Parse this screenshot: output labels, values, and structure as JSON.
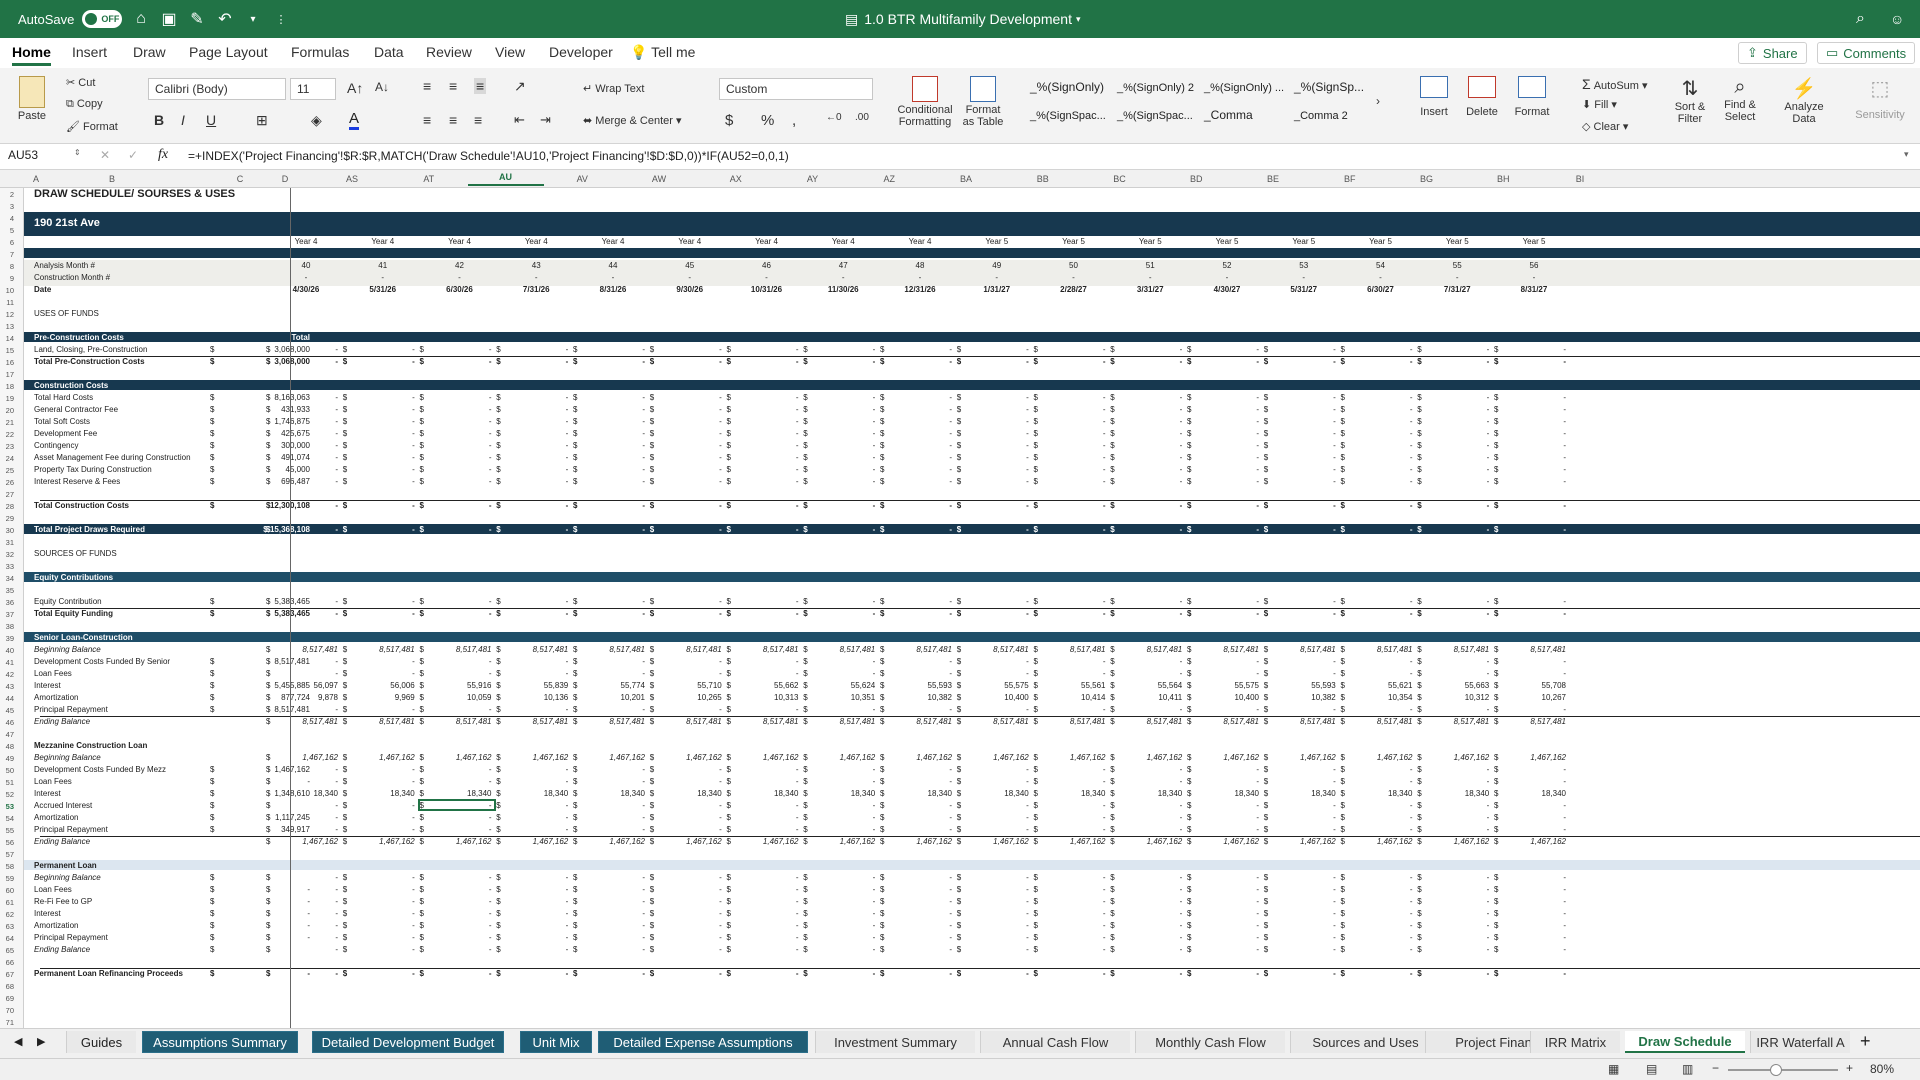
{
  "titlebar": {
    "autosave": "AutoSave",
    "autosave_state": "OFF",
    "doc_title": "1.0 BTR Multifamily Development"
  },
  "tabs": [
    "Home",
    "Insert",
    "Draw",
    "Page Layout",
    "Formulas",
    "Data",
    "Review",
    "View",
    "Developer"
  ],
  "tell_me": "Tell me",
  "share": "Share",
  "comments": "Comments",
  "ribbon": {
    "paste": "Paste",
    "cut": "Cut",
    "copy": "Copy",
    "format": "Format",
    "font_name": "Calibri (Body)",
    "font_size": "11",
    "wrap_text": "Wrap Text",
    "merge_center": "Merge & Center",
    "number_format": "Custom",
    "conditional": "Conditional",
    "formatting": "Formatting",
    "format_as": "Format",
    "as_table": "as Table",
    "styles": [
      "_%(SignOnly)",
      "_%(SignOnly) 2",
      "_%(SignOnly) ...",
      "_%(SignSp...",
      "_%(SignSpac...",
      "_%(SignSpac...",
      "_Comma",
      "_Comma 2"
    ],
    "insert": "Insert",
    "delete": "Delete",
    "format_cells": "Format",
    "autosum": "AutoSum",
    "fill": "Fill",
    "clear": "Clear",
    "sort": "Sort &",
    "filter": "Filter",
    "find": "Find &",
    "select": "Select",
    "analyze": "Analyze",
    "data": "Data",
    "sensitivity": "Sensitivity"
  },
  "formula": {
    "name_box": "AU53",
    "fx": "fx",
    "text": "=+INDEX('Project Financing'!$R:$R,MATCH('Draw Schedule'!AU10,'Project Financing'!$D:$D,0))*IF(AU52=0,0,1)"
  },
  "col_letters": [
    "A",
    "B",
    "C",
    "D",
    "AS",
    "AT",
    "AU",
    "AV",
    "AW",
    "AX",
    "AY",
    "AZ",
    "BA",
    "BB",
    "BC",
    "BD",
    "BE",
    "BF",
    "BG",
    "BH",
    "BI"
  ],
  "rows": [
    "2",
    "3",
    "4",
    "5",
    "6",
    "7",
    "8",
    "9",
    "10",
    "11",
    "12",
    "13",
    "14",
    "15",
    "16",
    "17",
    "18",
    "19",
    "20",
    "21",
    "22",
    "23",
    "24",
    "25",
    "26",
    "27",
    "28",
    "29",
    "30",
    "31",
    "32",
    "33",
    "34",
    "35",
    "36",
    "37",
    "38",
    "39",
    "40",
    "41",
    "42",
    "43",
    "44",
    "45",
    "46",
    "47",
    "48",
    "49",
    "50",
    "51",
    "52",
    "53",
    "54",
    "55",
    "56",
    "57",
    "58",
    "59",
    "60",
    "61",
    "62",
    "63",
    "64",
    "65",
    "66",
    "67",
    "68",
    "69",
    "70",
    "71"
  ],
  "sheet": {
    "title": "DRAW SCHEDULE/ SOURSES & USES",
    "property": "190 21st Ave",
    "years": [
      "Year 4",
      "Year 4",
      "Year 4",
      "Year 4",
      "Year 4",
      "Year 4",
      "Year 4",
      "Year 4",
      "Year 4",
      "Year 5",
      "Year 5",
      "Year 5",
      "Year 5",
      "Year 5",
      "Year 5",
      "Year 5",
      "Year 5"
    ],
    "analysis_label": "Analysis Month #",
    "construction_label": "Construction Month #",
    "date_label": "Date",
    "months": [
      "40",
      "41",
      "42",
      "43",
      "44",
      "45",
      "46",
      "47",
      "48",
      "49",
      "50",
      "51",
      "52",
      "53",
      "54",
      "55",
      "56"
    ],
    "dashes": [
      "-",
      "-",
      "-",
      "-",
      "-",
      "-",
      "-",
      "-",
      "-",
      "-",
      "-",
      "-",
      "-",
      "-",
      "-",
      "-",
      "-"
    ],
    "dates": [
      "4/30/26",
      "5/31/26",
      "6/30/26",
      "7/31/26",
      "8/31/26",
      "9/30/26",
      "10/31/26",
      "11/30/26",
      "12/31/26",
      "1/31/27",
      "2/28/27",
      "3/31/27",
      "4/30/27",
      "5/31/27",
      "6/30/27",
      "7/31/27",
      "8/31/27"
    ],
    "uses": "USES OF FUNDS",
    "sources": "SOURCES OF FUNDS",
    "pre_hdr": "Pre-Construction Costs",
    "total_hdr": "Total",
    "lines": [
      {
        "row": 15,
        "label": "Land, Closing, Pre-Construction",
        "val": "3,068,000",
        "pd": true
      },
      {
        "row": 16,
        "label": "Total Pre-Construction Costs",
        "val": "3,068,000",
        "pd": true,
        "bold": true
      },
      {
        "row": 19,
        "label": "Total Hard Costs",
        "val": "8,163,063",
        "pd": true
      },
      {
        "row": 20,
        "label": "General Contractor Fee",
        "val": "431,933",
        "pd": true
      },
      {
        "row": 21,
        "label": "Total Soft Costs",
        "val": "1,746,875",
        "pd": true
      },
      {
        "row": 22,
        "label": "Development Fee",
        "val": "425,675",
        "pd": true
      },
      {
        "row": 23,
        "label": "Contingency",
        "val": "300,000",
        "pd": true
      },
      {
        "row": 24,
        "label": "Asset Management Fee during Construction",
        "val": "491,074",
        "pd": true
      },
      {
        "row": 25,
        "label": "Property Tax During Construction",
        "val": "45,000",
        "pd": true
      },
      {
        "row": 26,
        "label": "Interest Reserve & Fees",
        "val": "696,487",
        "pd": true
      },
      {
        "row": 28,
        "label": "Total Construction Costs",
        "val": "12,300,108",
        "pd": true,
        "bold": true
      },
      {
        "row": 36,
        "label": "Equity Contribution",
        "val": "5,383,465",
        "pd": true
      },
      {
        "row": 37,
        "label": "Total Equity Funding",
        "val": "5,383,465",
        "pd": true,
        "bold": true
      },
      {
        "row": 41,
        "label": "Development Costs Funded By Senior",
        "val": "8,517,481",
        "pd": true
      },
      {
        "row": 42,
        "label": "Loan Fees",
        "val": "",
        "pd": true
      },
      {
        "row": 45,
        "label": "Principal Repayment",
        "val": "8,517,481",
        "pd": true
      },
      {
        "row": 50,
        "label": "Development Costs Funded By Mezz",
        "val": "1,467,162",
        "pd": true
      },
      {
        "row": 51,
        "label": "Loan Fees",
        "val": "-",
        "pd": true
      },
      {
        "row": 53,
        "label": "Accrued Interest",
        "val": "",
        "pd": true
      },
      {
        "row": 55,
        "label": "Principal Repayment",
        "val": "349,917",
        "pd": true
      },
      {
        "row": 59,
        "label": "Beginning Balance",
        "val": "",
        "pd": true,
        "italic": true
      },
      {
        "row": 60,
        "label": "Loan Fees",
        "val": "-",
        "pd": true
      },
      {
        "row": 61,
        "label": "Re-Fi Fee to GP",
        "val": "-",
        "pd": true
      },
      {
        "row": 62,
        "label": "Interest",
        "val": "-",
        "pd": true
      },
      {
        "row": 63,
        "label": "Amortization",
        "val": "-",
        "pd": true
      },
      {
        "row": 64,
        "label": "Principal Repayment",
        "val": "-",
        "pd": true
      },
      {
        "row": 65,
        "label": "Ending Balance",
        "val": "",
        "pd": true,
        "italic": true
      },
      {
        "row": 67,
        "label": "Permanent Loan Refinancing Proceeds",
        "val": "-",
        "pd": true,
        "bold": true
      }
    ],
    "con_hdr": "Construction Costs",
    "total_draws": "Total Project Draws Required",
    "total_draws_val": "$ 15,368,108",
    "eq_hdr": "Equity Contributions",
    "senior_hdr": "Senior Loan-Construction",
    "mezz_hdr": "Mezzanine Construction Loan",
    "perm_hdr": "Permanent Loan",
    "senior_begin": "Beginning Balance",
    "senior_end": "Ending Balance",
    "senior_balance": [
      "8,517,481",
      "8,517,481",
      "8,517,481",
      "8,517,481",
      "8,517,481",
      "8,517,481",
      "8,517,481",
      "8,517,481",
      "8,517,481",
      "8,517,481",
      "8,517,481",
      "8,517,481",
      "8,517,481",
      "8,517,481",
      "8,517,481",
      "8,517,481",
      "8,517,481"
    ],
    "interest_label": "Interest",
    "interest_total": "5,455,885",
    "senior_interest": [
      "56,097",
      "56,006",
      "55,916",
      "55,839",
      "55,774",
      "55,710",
      "55,662",
      "55,624",
      "55,593",
      "55,575",
      "55,561",
      "55,564",
      "55,575",
      "55,593",
      "55,621",
      "55,663",
      "55,708"
    ],
    "amort_label": "Amortization",
    "amort_total": "877,724",
    "senior_amort": [
      "9,878",
      "9,969",
      "10,059",
      "10,136",
      "10,201",
      "10,265",
      "10,313",
      "10,351",
      "10,382",
      "10,400",
      "10,414",
      "10,411",
      "10,400",
      "10,382",
      "10,354",
      "10,312",
      "10,267"
    ],
    "mezz_begin": "Beginning Balance",
    "mezz_end": "Ending Balance",
    "mezz_balance": [
      "1,467,162",
      "1,467,162",
      "1,467,162",
      "1,467,162",
      "1,467,162",
      "1,467,162",
      "1,467,162",
      "1,467,162",
      "1,467,162",
      "1,467,162",
      "1,467,162",
      "1,467,162",
      "1,467,162",
      "1,467,162",
      "1,467,162",
      "1,467,162",
      "1,467,162"
    ],
    "mezz_interest_total": "1,348,610",
    "mezz_interest": [
      "18,340",
      "18,340",
      "18,340",
      "18,340",
      "18,340",
      "18,340",
      "18,340",
      "18,340",
      "18,340",
      "18,340",
      "18,340",
      "18,340",
      "18,340",
      "18,340",
      "18,340",
      "18,340",
      "18,340"
    ],
    "mezz_amort_total": "1,117,245",
    "dollar": "$"
  },
  "sheet_tabs": [
    "Guides",
    "Assumptions Summary",
    "Detailed Development Budget",
    "Unit Mix",
    "Detailed Expense Assumptions",
    "Investment Summary",
    "Annual Cash Flow",
    "Monthly Cash Flow",
    "Sources and Uses",
    "Project Financing",
    "IRR Matrix",
    "Draw Schedule",
    "IRR Waterfall A"
  ],
  "zoom": "80%",
  "colors": {
    "excel_green": "#217346",
    "navy_band": "#17384f",
    "tab_dark": "#1f5d75",
    "perm_band": "#dce6f0"
  }
}
